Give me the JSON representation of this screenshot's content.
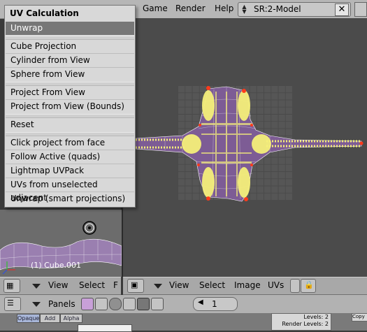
{
  "topbar": {
    "menus": [
      "Game",
      "Render",
      "Help"
    ],
    "scene": "SR:2-Model",
    "close_glyph": "✕"
  },
  "popup": {
    "title": "UV Calculation",
    "items": [
      "Unwrap",
      "Cube Projection",
      "Cylinder from View",
      "Sphere from View",
      "Project From View",
      "Project from View (Bounds)",
      "Reset",
      "Click project from face",
      "Follow Active (quads)",
      "Lightmap UVPack",
      "UVs from unselected adjacent",
      "Unwrap (smart projections)"
    ],
    "selected": "Unwrap"
  },
  "view3d": {
    "object_label": "(1) Cube.001"
  },
  "header_left": {
    "menus": [
      "View",
      "Select",
      "F"
    ]
  },
  "header_uv": {
    "menus": [
      "View",
      "Select",
      "Image",
      "UVs"
    ]
  },
  "buttons_header": {
    "panels_label": "Panels",
    "page_number": "1"
  },
  "buttons_strip": {
    "tabs": [
      "Opaque",
      "Add",
      "Alpha"
    ],
    "levels": "Levels: 2",
    "render_levels": "Render Levels: 2",
    "copy": "Copy"
  },
  "colors": {
    "uv_vertex": "#f5ef7a",
    "uv_edge": "#ffffff",
    "uv_face": "#8a5fa8",
    "uv_selected_corner": "#ff3a1a",
    "menu_highlight": "#777777"
  }
}
